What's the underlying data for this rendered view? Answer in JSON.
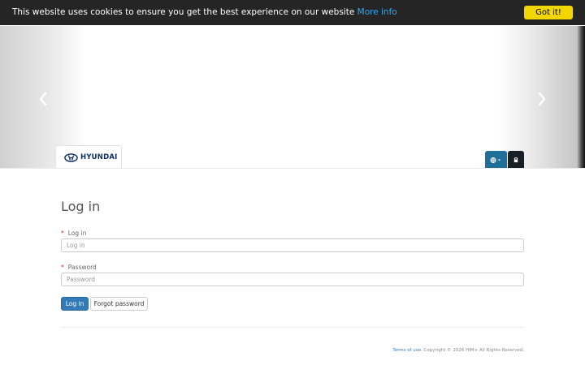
{
  "cookie_bar": {
    "message": "This website uses cookies to ensure you get the best experience on our website",
    "link_text": "More info",
    "button_label": "Got it!"
  },
  "brand": {
    "name": "HYUNDAI",
    "color": "#0c2e5e"
  },
  "toolbar": {
    "language_icon": "globe-icon",
    "lock_icon": "lock-icon"
  },
  "carousel": {
    "prev_icon": "chevron-left-icon",
    "next_icon": "chevron-right-icon"
  },
  "login_form": {
    "title": "Log in",
    "login_field": {
      "label": "Log in",
      "placeholder": "Log in",
      "required_mark": "*"
    },
    "password_field": {
      "label": "Password",
      "placeholder": "Password",
      "required_mark": "*"
    },
    "submit_label": "Log in",
    "forgot_label": "Forgot password"
  },
  "footer": {
    "terms_link": "Terms of use",
    "copyright": ". Copyright © 2026 HIM+ All Rights Reserved."
  },
  "colors": {
    "primary": "#337ab7",
    "cookie_bar": "#252525",
    "cookie_button": "#f1d600",
    "lang_button": "#1f6f98",
    "lock_button": "#1a2028"
  }
}
